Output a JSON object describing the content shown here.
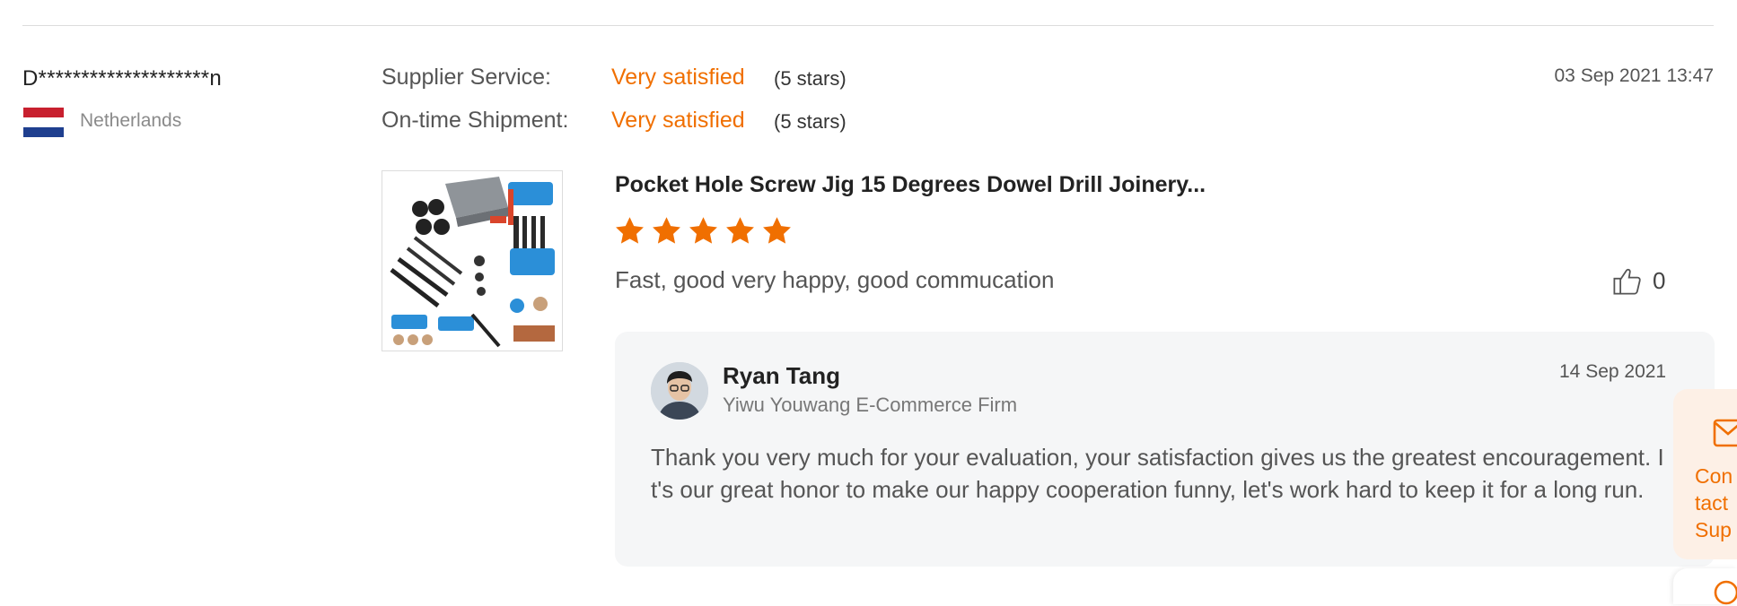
{
  "review": {
    "reviewer_name": "D********************n",
    "country": "Netherlands",
    "date": "03 Sep 2021 13:47",
    "ratings": [
      {
        "label": "Supplier Service:",
        "value": "Very satisfied",
        "stars_text": "(5 stars)"
      },
      {
        "label": "On-time Shipment:",
        "value": "Very satisfied",
        "stars_text": "(5 stars)"
      }
    ],
    "product_title": "Pocket Hole Screw Jig 15 Degrees Dowel Drill Joinery...",
    "star_rating": 5,
    "text": "Fast, good very happy, good commucation",
    "likes": "0"
  },
  "reply": {
    "name": "Ryan Tang",
    "company": "Yiwu Youwang E-Commerce Firm",
    "date": "14 Sep 2021",
    "text": "Thank you very much for your evaluation, your satisfaction gives us the greatest encouragement. It's our great honor to make our happy cooperation funny, let's work hard to keep it for a long run."
  },
  "contact_panel": {
    "label": "Contact Supplier"
  },
  "colors": {
    "accent": "#f06f00",
    "reply_bg": "#f5f6f7",
    "contact_bg": "#fdf0e6"
  }
}
